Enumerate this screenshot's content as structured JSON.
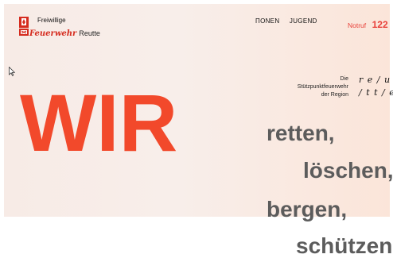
{
  "header": {
    "logo": {
      "line1": "Freiwillige",
      "brand": "Feuerwehr",
      "place": "Reutte",
      "emblem_icon": "fire-brigade-crest-icon"
    },
    "nav": [
      {
        "label": "ΠONEN"
      },
      {
        "label": "JUGEND"
      }
    ],
    "emergency": {
      "label": "Notruf",
      "number": "122"
    }
  },
  "hero": {
    "tagline": [
      "Die",
      "Stützpunktfeuerwehr",
      "der Region"
    ],
    "reutte_mark": [
      "r e / u",
      "/ t t / e"
    ],
    "headline": "WIR",
    "verbs": [
      "retten,",
      "löschen,",
      "bergen,",
      "schützen"
    ]
  },
  "colors": {
    "accent": "#f2492b",
    "brand_red": "#d52b1e",
    "verb_gray": "#5c5c5c",
    "hero_bg": "#f7ebe6"
  }
}
